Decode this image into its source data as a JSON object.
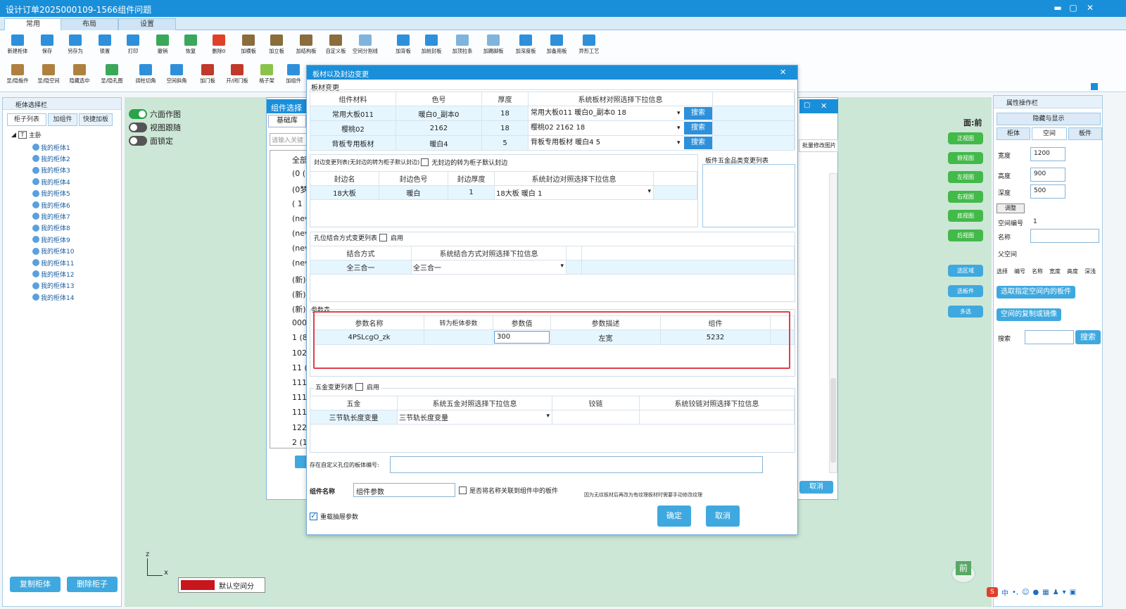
{
  "window": {
    "title": "设计订单2025000109-1566组件问题",
    "min": "▬",
    "max": "▢",
    "close": "✕"
  },
  "ribbon": {
    "tabs": [
      "常用",
      "布局",
      "设置"
    ],
    "row1": [
      "新建柜体",
      "保存",
      "另存为",
      "锁置",
      "打印",
      "撤销",
      "恢复",
      "删除0",
      "加横板",
      "加立板",
      "加结构板",
      "自定义板",
      "空间分割线",
      "加背板",
      "加前封板",
      "加顶拉条",
      "加踢脚板",
      "加深度板",
      "加备用板",
      "异形工艺"
    ],
    "row2": [
      "显/隐板件",
      "显/隐空间",
      "隐藏选中",
      "显/隐孔图",
      "阔柱切角",
      "空间斜角",
      "加门板",
      "开/闭门板",
      "格子架",
      "加组件"
    ]
  },
  "left": {
    "header": "柜体选择栏",
    "tabs": [
      "柜子列表",
      "加组件",
      "快捷加板"
    ],
    "root": "主卧",
    "items": [
      "我的柜体1",
      "我的柜体2",
      "我的柜体3",
      "我的柜体4",
      "我的柜体5",
      "我的柜体6",
      "我的柜体7",
      "我的柜体8",
      "我的柜体9",
      "我的柜体10",
      "我的柜体11",
      "我的柜体12",
      "我的柜体13",
      "我的柜体14"
    ],
    "copy_btn": "复制柜体",
    "delete_btn": "删除柜子"
  },
  "canvas": {
    "toggles": [
      "六面作图",
      "视图跟随",
      "面锁定"
    ],
    "view_label": "面:前",
    "view_buttons": [
      "正视图",
      "俯视图",
      "左视图",
      "右视图",
      "底视图",
      "后视图"
    ],
    "select_buttons": [
      "选区域",
      "选板件",
      "多选"
    ],
    "axis_z": "z",
    "axis_x": "x",
    "default_space": "默认空间分",
    "front_badge": "前"
  },
  "backdlg": {
    "title": "组件选择",
    "tab": "基础库",
    "search_placeholder": "请输入关键",
    "list": [
      "全部",
      "(0 (1",
      "(0梦",
      "( 1",
      "(nev",
      "(nev",
      "(nev",
      "(nev",
      "(新)(",
      "(新)(",
      "(新)",
      "000(",
      "1 (8)",
      "102",
      "11 (",
      "111",
      "111",
      "111",
      "122",
      "2 (1"
    ],
    "side_label": "批量修改图片",
    "cancel": "取消",
    "max": "▢",
    "close": "✕"
  },
  "dialog": {
    "title": "板材以及封边变更",
    "close": "✕",
    "board_section": "板材变更",
    "board_headers": [
      "组件材料",
      "色号",
      "厚度",
      "系统板材对照选择下拉信息"
    ],
    "board_rows": [
      {
        "material": "常用大板011",
        "color": "暖白0_副本0",
        "thick": "18",
        "sys": "常用大板011 暖白0_副本0 18",
        "btn": "搜索"
      },
      {
        "material": "樱桃02",
        "color": "2162",
        "thick": "18",
        "sys": "樱桃02 2162 18",
        "btn": "搜索"
      },
      {
        "material": "背板专用板材",
        "color": "暖白4",
        "thick": "5",
        "sys": "背板专用板材 暖白4 5",
        "btn": "搜索"
      }
    ],
    "edge_section": "封边变更列表(无封边的转为柜子默认封边)",
    "edge_checkbox": "无封边的转为柜子默认封边",
    "edge_headers": [
      "封边名",
      "封边色号",
      "封边厚度",
      "系统封边对照选择下拉信息"
    ],
    "edge_row": {
      "name": "18大板",
      "color": "暖白",
      "thick": "1",
      "sys": "18大板 暖白 1"
    },
    "hardware_list_title": "板件五金品类变更列表",
    "hole_section": "孔位结合方式变更列表",
    "hole_enable": "启用",
    "hole_headers": [
      "结合方式",
      "系统结合方式对照选择下拉信息"
    ],
    "hole_row": {
      "mode": "全三合一",
      "sys": "全三合一"
    },
    "param_section": "参数表",
    "param_headers": [
      "参数名称",
      "转为柜体参数",
      "参数值",
      "参数描述",
      "组件"
    ],
    "param_row": {
      "name": "4PSLcgO_zk",
      "convert": "",
      "value": "300",
      "desc": "左宽",
      "comp": "5232"
    },
    "hw_section": "五金变更列表",
    "hw_enable": "启用",
    "hw_headers": [
      "五金",
      "系统五金对照选择下拉信息",
      "铰链",
      "系统铰链对照选择下拉信息"
    ],
    "hw_row": {
      "hw": "三节轨长度变量",
      "sys": "三节轨长度变量"
    },
    "hole_board_label": "存在自定义孔位的板体编号:",
    "comp_name_label": "组件名称",
    "comp_name_value": "组件参数",
    "link_checkbox": "是否将名称关联到组件中的板件",
    "note": "因为无纹板材后再改为有纹理板材时需要手动修改纹理",
    "reload_checkbox": "重载抽屉参数",
    "ok": "确定",
    "cancel": "取消"
  },
  "right": {
    "header": "属性操作栏",
    "hide_show": "隐藏与显示",
    "tabs": [
      "柜体",
      "空间",
      "板件"
    ],
    "width_label": "宽度",
    "width": "1200",
    "height_label": "高度",
    "height": "900",
    "depth_label": "深度",
    "depth": "500",
    "adjust_btn": "调整",
    "space_no_label": "空间编号",
    "space_no": "1",
    "name_label": "名称",
    "parent_label": "父空间",
    "cols": [
      "选择",
      "编号",
      "名称",
      "宽度",
      "高度",
      "深浅"
    ],
    "btn_select_space": "选取指定空间内的板件",
    "btn_copy_mirror": "空间的复制或镜像",
    "search_label": "搜索",
    "search_btn": "搜索"
  },
  "colors": {
    "accent": "#1a8fd9",
    "button": "#3fa9df",
    "canvas": "#cde7d6",
    "view_btn": "#43b94a",
    "highlight": "#e0404a"
  }
}
